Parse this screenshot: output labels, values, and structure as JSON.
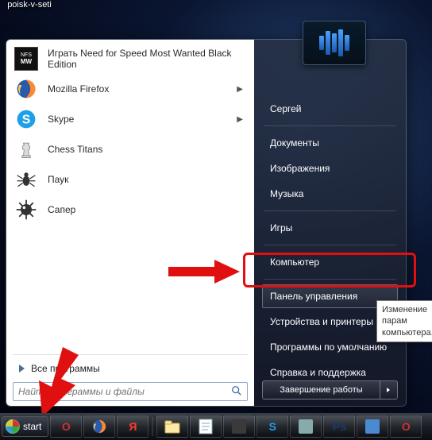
{
  "desktop": {
    "icon_label": "poisk-v-seti"
  },
  "start_menu": {
    "programs": [
      {
        "label": "Играть Need for Speed Most Wanted Black Edition",
        "icon": "nfs",
        "has_submenu": false
      },
      {
        "label": "Mozilla Firefox",
        "icon": "firefox",
        "has_submenu": true
      },
      {
        "label": "Skype",
        "icon": "skype",
        "has_submenu": true
      },
      {
        "label": "Chess Titans",
        "icon": "chess",
        "has_submenu": false
      },
      {
        "label": "Паук",
        "icon": "spider",
        "has_submenu": false
      },
      {
        "label": "Сапер",
        "icon": "minesweeper",
        "has_submenu": false
      }
    ],
    "all_programs_label": "Все программы",
    "search_placeholder": "Найти программы и файлы",
    "right_items": [
      {
        "label": "Сергей",
        "sep_after": true
      },
      {
        "label": "Документы"
      },
      {
        "label": "Изображения"
      },
      {
        "label": "Музыка",
        "sep_after": true
      },
      {
        "label": "Игры",
        "sep_after": true
      },
      {
        "label": "Компьютер",
        "sep_after": true
      },
      {
        "label": "Панель управления",
        "highlight": true
      },
      {
        "label": "Устройства и принтеры"
      },
      {
        "label": "Программы по умолчанию"
      },
      {
        "label": "Справка и поддержка"
      }
    ],
    "shutdown_label": "Завершение работы"
  },
  "tooltip": {
    "line1": "Изменение парам",
    "line2": "компьютера."
  },
  "taskbar": {
    "start_label": "start",
    "items": [
      {
        "name": "opera-icon",
        "color": "#d03030",
        "glyph": "O"
      },
      {
        "name": "firefox-icon",
        "color": "#ff8a2a",
        "glyph": ""
      },
      {
        "name": "yandex-icon",
        "color": "#ff3a2a",
        "glyph": "Я"
      },
      {
        "name": "separator"
      },
      {
        "name": "explorer-icon",
        "color": "#ffcc55",
        "glyph": ""
      },
      {
        "name": "notepad-icon",
        "color": "#cfe8ff",
        "glyph": ""
      },
      {
        "name": "device-icon",
        "color": "#3a3a3a",
        "glyph": ""
      },
      {
        "name": "skype-icon",
        "color": "#1ea0e8",
        "glyph": "S"
      },
      {
        "name": "tool-icon",
        "color": "#8aa",
        "glyph": ""
      },
      {
        "name": "photoshop-icon",
        "color": "#1a3a6a",
        "glyph": "Ps"
      },
      {
        "name": "app-icon",
        "color": "#4a8ad0",
        "glyph": ""
      },
      {
        "name": "opera2-icon",
        "color": "#d03030",
        "glyph": "O"
      }
    ]
  },
  "colors": {
    "annotation_red": "#e01010"
  }
}
